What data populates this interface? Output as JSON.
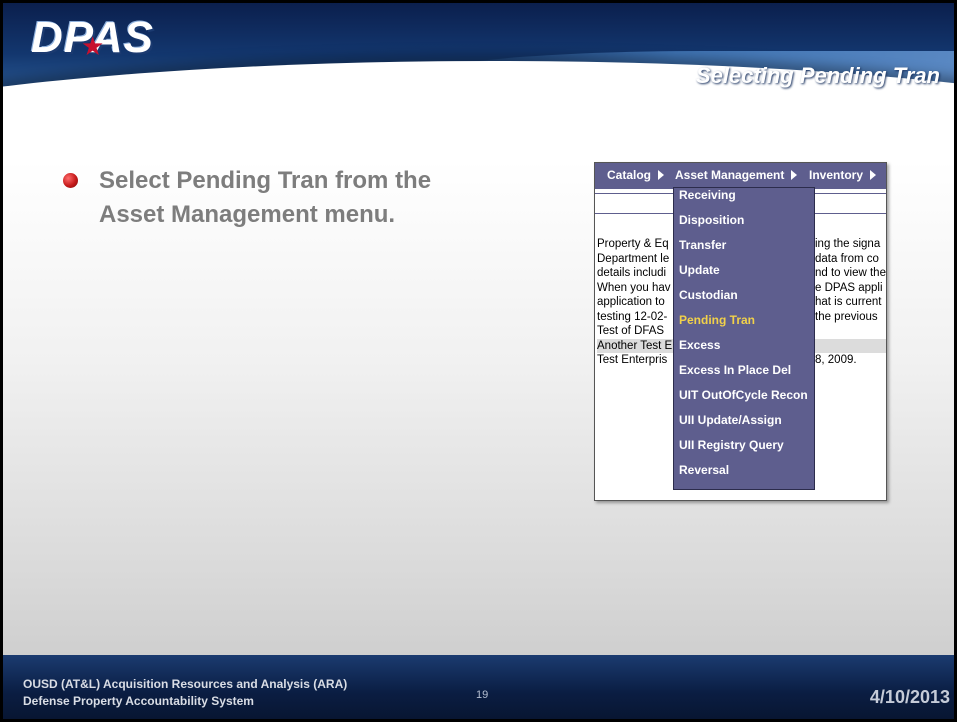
{
  "header": {
    "logo_text": "DPAS",
    "title": "Selecting Pending Tran"
  },
  "bullet": {
    "text": "Select Pending Tran from the Asset Management menu."
  },
  "menubar": {
    "items": [
      {
        "label": "Catalog"
      },
      {
        "label": "Asset Management"
      },
      {
        "label": "Inventory"
      }
    ]
  },
  "dropdown": {
    "items": [
      {
        "label": "Receiving"
      },
      {
        "label": "Disposition"
      },
      {
        "label": "Transfer"
      },
      {
        "label": "Update"
      },
      {
        "label": "Custodian"
      },
      {
        "label": "Pending Tran",
        "selected": true
      },
      {
        "label": "Excess"
      },
      {
        "label": "Excess In Place Del"
      },
      {
        "label": "UIT OutOfCycle Recon"
      },
      {
        "label": "UII Update/Assign"
      },
      {
        "label": "UII Registry Query"
      },
      {
        "label": "Reversal"
      }
    ]
  },
  "background_text": {
    "rows": [
      {
        "left": "Property & Eq",
        "right": "ing the signa"
      },
      {
        "left": "Department le",
        "right": "data from co"
      },
      {
        "left": "details includi",
        "right": "nd to view the"
      },
      {
        "left": "When you hav",
        "right": "e DPAS appli"
      },
      {
        "left": "application to",
        "right": "hat is current"
      },
      {
        "left": "testing 12-02-",
        "right": "the previous"
      },
      {
        "left": "Test of DFAS",
        "right": ""
      },
      {
        "left": "Another Test E",
        "right": ""
      },
      {
        "left": "Test Enterpris",
        "right": "8, 2009."
      }
    ]
  },
  "footer": {
    "line1": "OUSD (AT&L) Acquisition Resources and Analysis (ARA)",
    "line2": "Defense Property Accountability System",
    "page_number": "19",
    "date": "4/10/2013"
  },
  "colors": {
    "menu_bg": "#5e5e8e",
    "selected_item": "#f1d14a",
    "bullet_text": "#7d7d7d",
    "header_navy": "#0b1f4d"
  }
}
